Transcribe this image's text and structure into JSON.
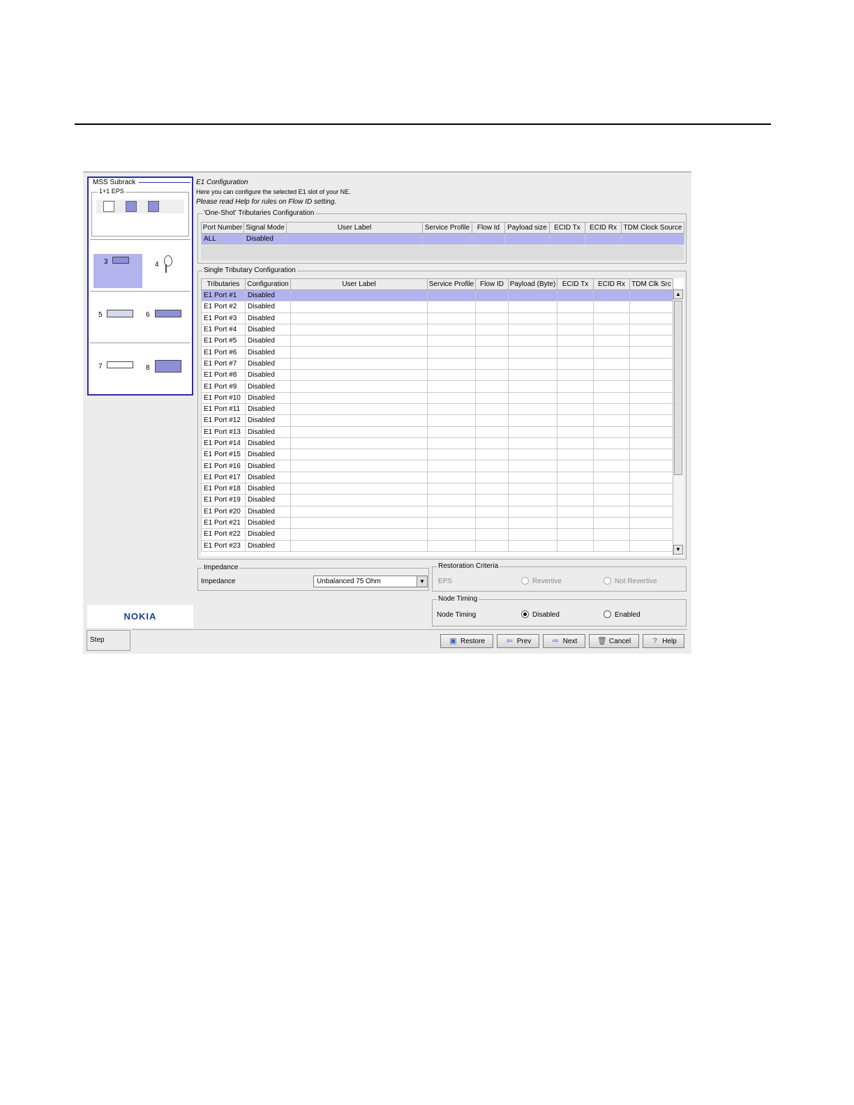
{
  "subrack": {
    "title": "MSS Subrack",
    "eps_label": "1+1 EPS",
    "slots": [
      "3",
      "4",
      "5",
      "6",
      "7",
      "8"
    ]
  },
  "header": {
    "title": "E1 Configuration",
    "description": "Here you can configure the selected E1 slot of your NE.",
    "help_note": "Please read Help for rules on Flow ID setting."
  },
  "one_shot": {
    "title": "'One-Shot' Tributaries Configuration",
    "columns": [
      "Port Number",
      "Signal Mode",
      "User Label",
      "Service Profile",
      "Flow Id",
      "Payload size",
      "ECID Tx",
      "ECID Rx",
      "TDM Clock Source"
    ],
    "row": [
      "ALL",
      "Disabled"
    ]
  },
  "single": {
    "title": "Single Tributary Configuration",
    "columns": [
      "Tributaries",
      "Configuration",
      "User Label",
      "Service Profile",
      "Flow ID",
      "Payload (Byte)",
      "ECID Tx",
      "ECID Rx",
      "TDM Clk Src"
    ],
    "rows": [
      [
        "E1 Port #1",
        "Disabled"
      ],
      [
        "E1 Port #2",
        "Disabled"
      ],
      [
        "E1 Port #3",
        "Disabled"
      ],
      [
        "E1 Port #4",
        "Disabled"
      ],
      [
        "E1 Port #5",
        "Disabled"
      ],
      [
        "E1 Port #6",
        "Disabled"
      ],
      [
        "E1 Port #7",
        "Disabled"
      ],
      [
        "E1 Port #8",
        "Disabled"
      ],
      [
        "E1 Port #9",
        "Disabled"
      ],
      [
        "E1 Port #10",
        "Disabled"
      ],
      [
        "E1 Port #11",
        "Disabled"
      ],
      [
        "E1 Port #12",
        "Disabled"
      ],
      [
        "E1 Port #13",
        "Disabled"
      ],
      [
        "E1 Port #14",
        "Disabled"
      ],
      [
        "E1 Port #15",
        "Disabled"
      ],
      [
        "E1 Port #16",
        "Disabled"
      ],
      [
        "E1 Port #17",
        "Disabled"
      ],
      [
        "E1 Port #18",
        "Disabled"
      ],
      [
        "E1 Port #19",
        "Disabled"
      ],
      [
        "E1 Port #20",
        "Disabled"
      ],
      [
        "E1 Port #21",
        "Disabled"
      ],
      [
        "E1 Port #22",
        "Disabled"
      ],
      [
        "E1 Port #23",
        "Disabled"
      ]
    ]
  },
  "impedance": {
    "title": "Impedance",
    "label": "Impedance",
    "value": "Unbalanced 75 Ohm"
  },
  "restoration": {
    "title": "Restoration Criteria",
    "label": "EPS",
    "options": [
      "Revertive",
      "Not Revertive"
    ]
  },
  "node_timing": {
    "title": "Node Timing",
    "label": "Node Timing",
    "options": [
      "Disabled",
      "Enabled"
    ],
    "selected": "Disabled"
  },
  "brand": "NOKIA",
  "step_label": "Step",
  "buttons": {
    "restore": "Restore",
    "prev": "Prev",
    "next": "Next",
    "cancel": "Cancel",
    "help": "Help"
  },
  "colors": {
    "selection": "#b3b3ee",
    "subrack_border": "#2a2aa8",
    "brand": "#1a3f9a"
  }
}
